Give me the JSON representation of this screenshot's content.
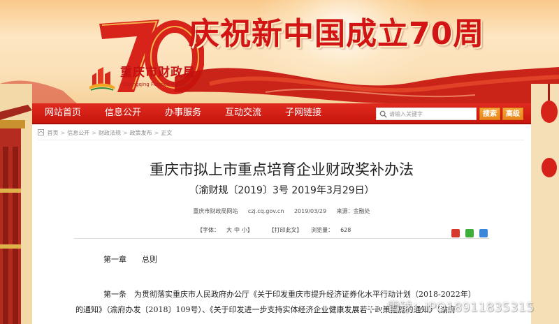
{
  "banner": {
    "slogan": "庆祝新中国成立70周",
    "anniversary_numeral": "70",
    "site_name": "重庆市财政局",
    "site_name_en": "Chongqing Finance Bureau"
  },
  "nav": {
    "items": [
      {
        "label": "网站首页"
      },
      {
        "label": "信息公开"
      },
      {
        "label": "办事服务"
      },
      {
        "label": "互动交流"
      },
      {
        "label": "子网链接"
      }
    ],
    "search_placeholder": "请输入关键字",
    "search_button": "搜索",
    "advanced_button": "高级"
  },
  "breadcrumb": {
    "items": [
      "首页",
      "信息公开",
      "财政法规",
      "政策发布",
      "正文"
    ],
    "separator": ">"
  },
  "article": {
    "title": "重庆市拟上市重点培育企业财政奖补办法",
    "doc_number": "（渝财规〔2019〕3号 2019年3月29日）",
    "meta": {
      "source_site": "重庆市财政局网站",
      "domain": "czj.cq.gov.cn",
      "date": "2019/03/29",
      "origin": "来源：金融处"
    },
    "tools": {
      "font_label": "【字体：",
      "font_sizes": [
        "大",
        "中",
        "小"
      ],
      "font_close": "】",
      "print_label": "【打印此文】",
      "views_label": "浏览量：",
      "views": "628"
    },
    "paragraphs": [
      "第一章　　总则",
      "第一条　为贯彻落实重庆市人民政府办公厅《关于印发重庆市提升经济证券化水平行动计划（2018-2022年）",
      "的通知》（渝府办发〔2018〕109号）、《关于印发进一步支持实体经济企业健康发展若干政策措施的通知》（渝府"
    ]
  },
  "watermark": {
    "text": "雪球：IPO18911835315"
  },
  "colors": {
    "nav_red": "#d21f15",
    "slogan_red": "#d31414",
    "button_orange": "#ee8f24",
    "page_bg": "#f7e3b8"
  }
}
